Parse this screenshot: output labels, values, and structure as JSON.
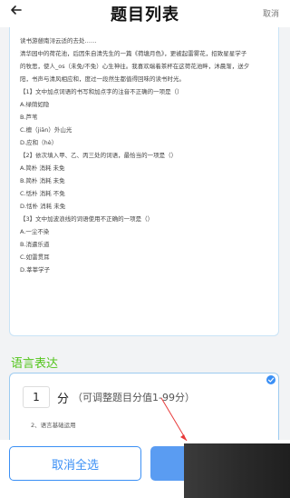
{
  "header": {
    "title": "题目列表",
    "cancel_label": "取消"
  },
  "question": {
    "lines": [
      "读书游憩南浔云适的去处……",
      "清华园中的荷花池，后因朱自清先生的一篇《荷塘月色》，更被起雷雾花，招致星星学子",
      "的牧思，使人_os（未免/不免）心生神往。我喜欢端着茶杯在这荷花池畔，沐晨渐，送夕",
      "阳，书声与清风相应和，度过一段然生都值得回味的读书时光。",
      "【1】文中加点词语的书写和加点字的注音不正确的一项是（）",
      "A.绿荫如隐",
      "B.芦苇",
      "C.檀（jiān）外山光",
      "D.应和（hè）",
      "【2】依次填入甲、乙、丙三处的词语，最恰当的一项是（）",
      "A.简朴 消耗 未免",
      "B.简朴 消耗 未免",
      "C.恬朴 消耗 不免",
      "D.恬朴 消耗 未免",
      "【3】文中加波浪线的词语使用不正确的一项是（）",
      "A.一尘不染",
      "B.消遣乐道",
      "C.如雷贯耳",
      "D.莘莘学子"
    ]
  },
  "section": {
    "title": "语言表达"
  },
  "score": {
    "value": "1",
    "unit": "分",
    "hint": "（可调整题目分值1-99分）"
  },
  "subquestion": {
    "text": "2、语言基础运用"
  },
  "bottom": {
    "deselect_label": "取消全选"
  },
  "colors": {
    "accent_blue": "#3a8ff5",
    "section_green": "#52c41a",
    "annotation_red": "#e83a3a"
  }
}
